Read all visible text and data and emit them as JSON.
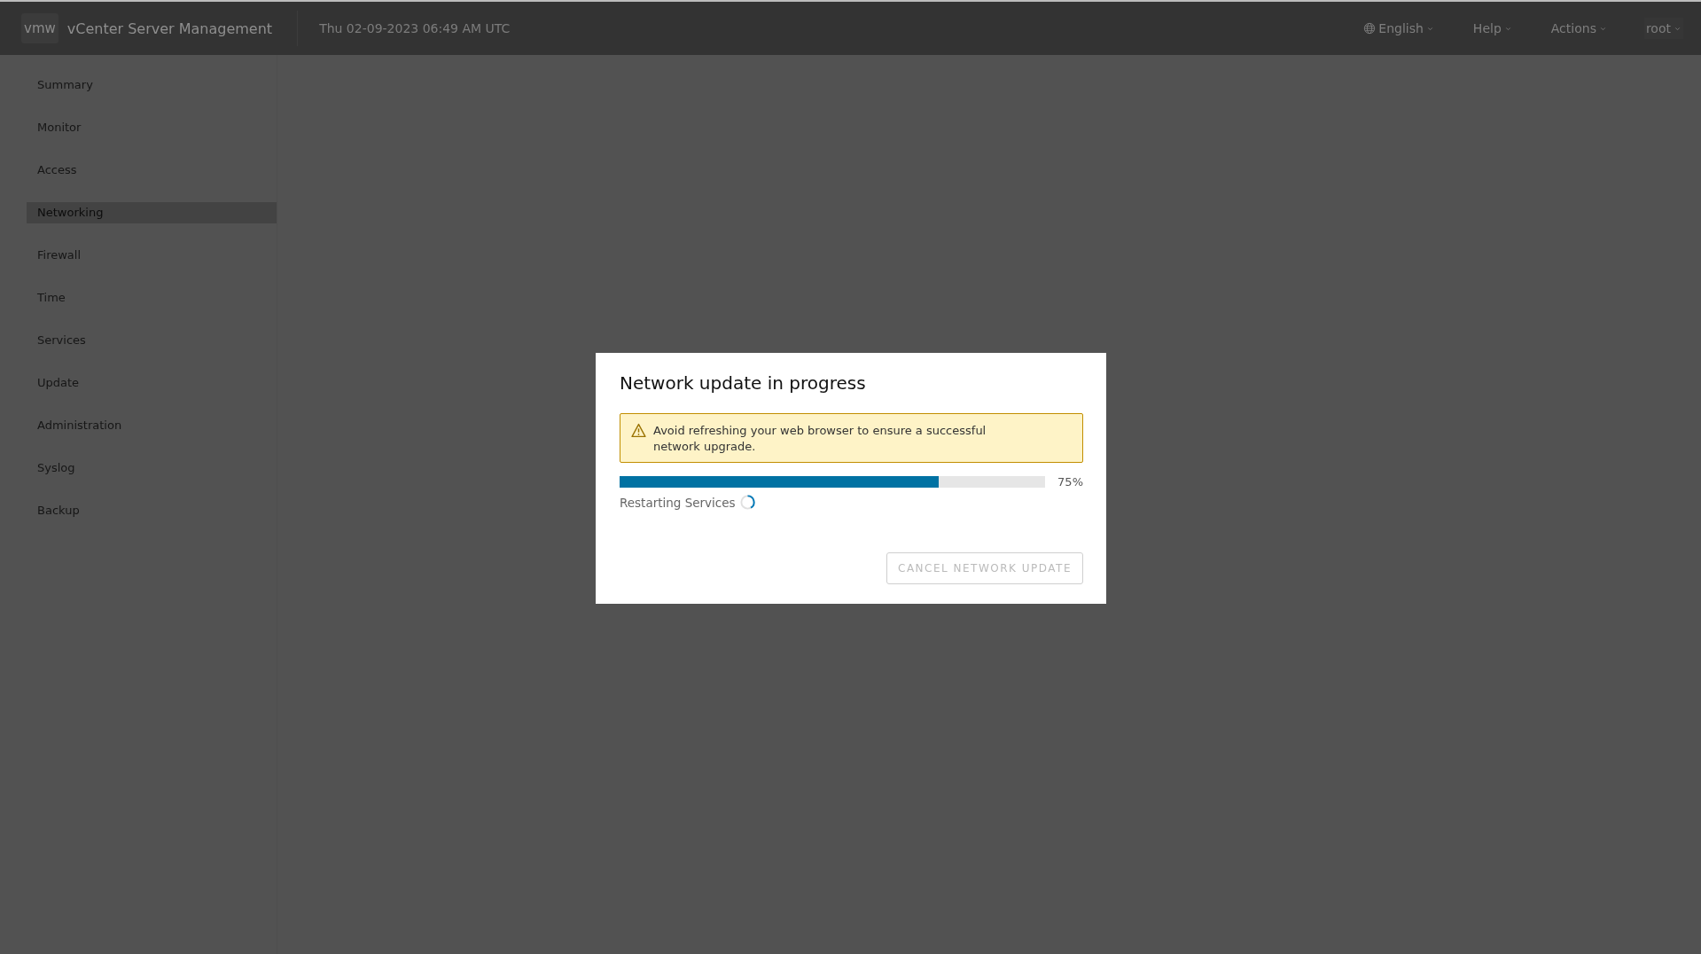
{
  "header": {
    "logo": "vmw",
    "title": "vCenter Server Management",
    "datetime": "Thu 02-09-2023 06:49 AM UTC",
    "menus": [
      {
        "kind": "language",
        "label": "English"
      },
      {
        "kind": "plain",
        "label": "Help"
      },
      {
        "kind": "plain",
        "label": "Actions"
      },
      {
        "kind": "user",
        "label": "root"
      }
    ]
  },
  "sidebar": {
    "items": [
      {
        "label": "Summary",
        "selected": false
      },
      {
        "label": "Monitor",
        "selected": false
      },
      {
        "label": "Access",
        "selected": false
      },
      {
        "label": "Networking",
        "selected": true
      },
      {
        "label": "Firewall",
        "selected": false
      },
      {
        "label": "Time",
        "selected": false
      },
      {
        "label": "Services",
        "selected": false
      },
      {
        "label": "Update",
        "selected": false
      },
      {
        "label": "Administration",
        "selected": false
      },
      {
        "label": "Syslog",
        "selected": false
      },
      {
        "label": "Backup",
        "selected": false
      }
    ]
  },
  "modal": {
    "title": "Network update in progress",
    "alert": {
      "kind": "warning",
      "text": "Avoid refreshing your web browser to ensure a successful network upgrade."
    },
    "progress": {
      "level": 0.75,
      "reading": "75%"
    },
    "status": "Restarting Services",
    "button": {
      "label": "CANCEL NETWORK UPDATE",
      "disabled": true
    }
  }
}
